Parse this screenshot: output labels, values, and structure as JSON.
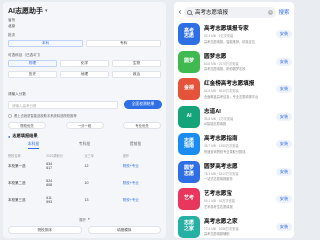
{
  "left": {
    "title": "AI志愿助手",
    "province_label": "省份",
    "province_value": "北京",
    "level_label": "批次",
    "level_options": [
      "本科",
      "专科"
    ],
    "subjects_label": "可选科目（已选3门）",
    "subjects": [
      [
        "物理",
        "化学",
        "生物"
      ],
      [
        "历史",
        "地理",
        "政治"
      ]
    ],
    "score_label": "请输入分数",
    "score_placeholder": "请输入高考分数",
    "submit_label": "全面校测结果",
    "tip": "看上去我是智能选校助手系统精选院校推荐",
    "chips": [
      "院校优先",
      "一分一段",
      "专业优先"
    ],
    "results_title": "志愿填报结果",
    "tabs": [
      "本科批",
      "专科批",
      "提前批"
    ],
    "table_headers": [
      "院校名称",
      "2023录取分",
      "近三年",
      "操作"
    ],
    "rows": [
      {
        "name": "本校第一选",
        "scores": [
          "634",
          "617"
        ],
        "rank": "12",
        "action": "院校+专业"
      },
      {
        "name": "本校第二选",
        "scores": [
          "624",
          "608"
        ],
        "rank": "10",
        "action": "院校+专业"
      },
      {
        "name": "本校第三选",
        "scores": [
          "611",
          "593"
        ],
        "rank": "13",
        "action": "院校+专业"
      }
    ],
    "sort_label": "展开",
    "bottom_buttons": [
      "院校排序",
      "填报模拟"
    ]
  },
  "right": {
    "query": "高考志愿填报",
    "search_button": "搜索",
    "install_label": "安装",
    "apps": [
      {
        "name": "高考志愿填报专家",
        "meta": "52.3 MB · 1亿次安装",
        "desc": "高考志愿填报，智能推荐，精准定位",
        "icon_text": "高考\n志愿",
        "color": "#2f6fe6"
      },
      {
        "name": "圆梦志愿",
        "meta": "83.8 MB · 2170万次安装",
        "desc": "高考志愿填报，助你圆梦名校",
        "icon_text": "圆梦",
        "color": "#3fb950"
      },
      {
        "name": "红金榜高考志愿填报",
        "meta": "64.6 MB · 5610万次安装",
        "desc": "全面覆盖高考信息，专业志愿填报平台",
        "icon_text": "金榜",
        "color": "#e5533a"
      },
      {
        "name": "志道AI",
        "meta": "35.8 MB · 1万次安装",
        "desc": "AI智能志愿填报",
        "icon_text": "AI",
        "color": "#15a37a"
      },
      {
        "name": "高考志愿指南",
        "meta": "35.7 MB · 1280万次安装",
        "desc": "快速查询院校专业录取分数线",
        "icon_text": "志愿\n指南",
        "color": "#1c8df0"
      },
      {
        "name": "圆梦高考志愿",
        "meta": "78.3 MB · 3310万次安装",
        "desc": "一站式志愿填报服务",
        "icon_text": "圆梦\n志愿",
        "color": "#2f6fe6"
      },
      {
        "name": "艺考志愿宝",
        "meta": "55.1 MB · 63万次安装",
        "desc": "艺术类考生志愿填报",
        "icon_text": "艺考",
        "color": "#e8365d"
      },
      {
        "name": "高考志愿之家",
        "meta": "72.4 MB · 1056万次安装",
        "desc": "高考志愿填报辅助",
        "icon_text": "志愿\n之家",
        "color": "#26b0a4"
      }
    ]
  }
}
